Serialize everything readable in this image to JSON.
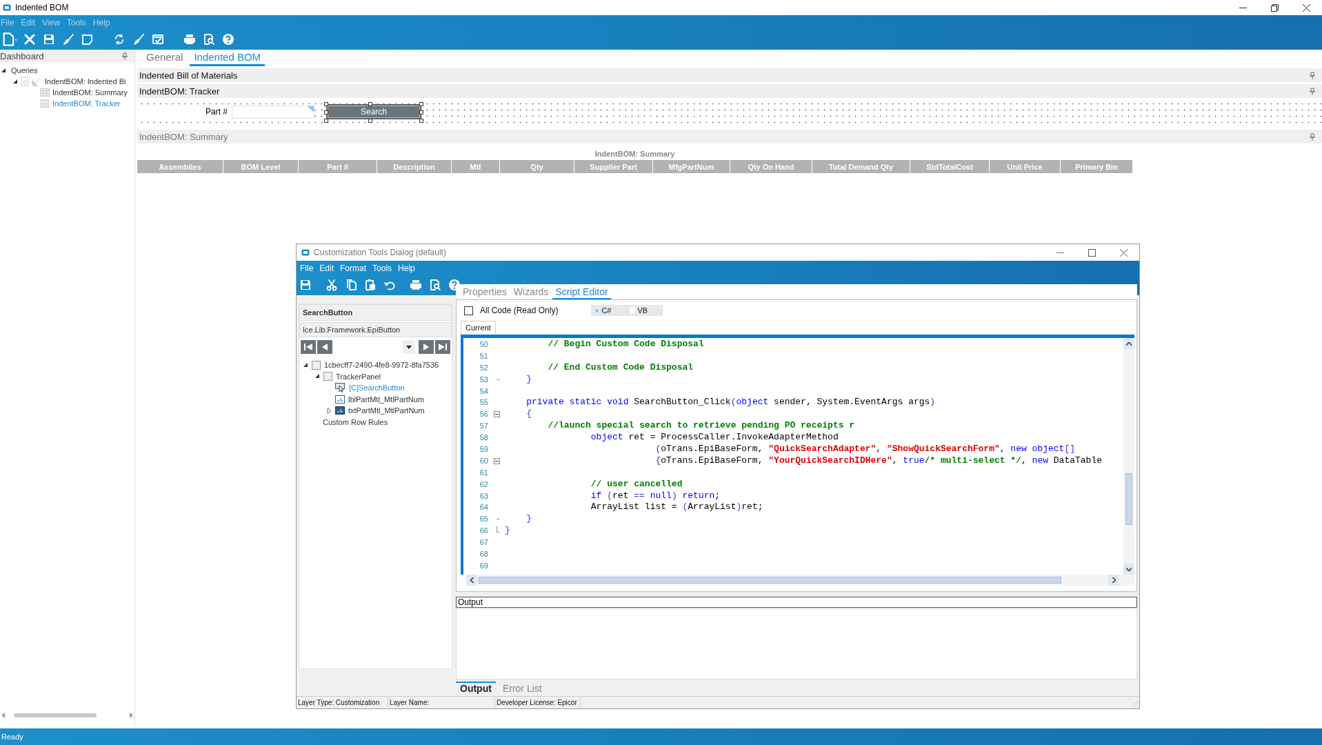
{
  "window": {
    "title": "Indented BOM"
  },
  "menu": [
    {
      "label": "File",
      "disabled": true
    },
    {
      "label": "Edit",
      "disabled": true
    },
    {
      "label": "View",
      "disabled": true
    },
    {
      "label": "Tools",
      "disabled": true
    },
    {
      "label": "Help",
      "disabled": true
    }
  ],
  "sidebar": {
    "title": "Dashboard",
    "tree": [
      {
        "label": "Queries",
        "expanded": true,
        "selected": false,
        "children": [
          {
            "label": "IndentBOM: Indented Bi",
            "kind": "query",
            "expanded": true,
            "selected": false,
            "children": [
              {
                "label": "IndentBOM: Summary",
                "kind": "grid",
                "selected": false
              },
              {
                "label": "IndentBOM: Tracker",
                "kind": "tracker",
                "selected": true
              }
            ]
          }
        ]
      }
    ]
  },
  "tabs": [
    {
      "label": "General",
      "selected": false
    },
    {
      "label": "Indented BOM",
      "selected": true
    }
  ],
  "header_panel": {
    "title": "Indented Bill of Materials"
  },
  "tracker": {
    "title": "IndentBOM: Tracker",
    "field_label": "Part #",
    "button": "Search"
  },
  "summary": {
    "title": "IndentBOM: Summary",
    "grid_title": "IndentBOM: Summary",
    "columns": [
      "Assemblies",
      "BOM Level",
      "Part #",
      "Description",
      "Mtl",
      "Qty",
      "Supplier Part",
      "MfgPartNum",
      "Qty On Hand",
      "Total Demand Qty",
      "StdTotalCost",
      "Unit Price",
      "Primary Bin"
    ]
  },
  "status_bar": "Ready",
  "dialog": {
    "title": "Customization Tools Dialog (default)",
    "menu": [
      "File",
      "Edit",
      "Format",
      "Tools",
      "Help"
    ],
    "control_name": "SearchButton",
    "control_type": "Ice.Lib.Framework.EpiButton",
    "tree": [
      {
        "label": "1cbecff7-2490-4fe8-9972-8fa7536",
        "kind": "panel",
        "expanded": true,
        "selected": false,
        "children": [
          {
            "label": "TrackerPanel",
            "kind": "panel",
            "expanded": true,
            "selected": false,
            "children": [
              {
                "label": "[C]SearchButton",
                "kind": "button",
                "selected": true
              },
              {
                "label": "lblPartMtl_MtlPartNum",
                "kind": "label",
                "selected": false
              },
              {
                "label": "txtPartMtl_MtlPartNum",
                "kind": "textbox",
                "expanded": false,
                "selected": false
              }
            ]
          }
        ]
      },
      {
        "label": "Custom Row Rules",
        "kind": "rules",
        "selected": false
      }
    ],
    "tabs": [
      {
        "label": "Properties",
        "selected": false
      },
      {
        "label": "Wizards",
        "selected": false
      },
      {
        "label": "Script Editor",
        "selected": true
      }
    ],
    "all_code": {
      "label": "All Code (Read Only)",
      "checked": false
    },
    "languages": [
      {
        "label": "C#",
        "selected": true
      },
      {
        "label": "VB",
        "selected": false
      }
    ],
    "code_tabs": [
      {
        "label": "Current",
        "selected": true
      }
    ],
    "code_lines": [
      {
        "number": "50",
        "kind": "plain",
        "tokens": [
          {
            "kind": "comment",
            "text": "        // Begin Custom Code Disposal"
          }
        ]
      },
      {
        "number": "51",
        "kind": "plain"
      },
      {
        "number": "52",
        "kind": "plain",
        "tokens": [
          {
            "kind": "comment",
            "text": "        // End Custom Code Disposal"
          }
        ]
      },
      {
        "number": "53",
        "kind": "end",
        "tokens": [
          {
            "kind": "punct",
            "text": "    }"
          }
        ]
      },
      {
        "number": "54",
        "kind": "plain"
      },
      {
        "number": "55",
        "kind": "plain",
        "tokens": [
          {
            "kind": "kw",
            "text": "    private static void"
          },
          {
            "kind": "plain",
            "text": " SearchButton_Click"
          },
          {
            "kind": "punct",
            "text": "("
          },
          {
            "kind": "kw",
            "text": "object"
          },
          {
            "kind": "plain",
            "text": " sender, System.EventArgs args"
          },
          {
            "kind": "punct",
            "text": ")"
          }
        ]
      },
      {
        "number": "56",
        "kind": "collapse",
        "tokens": [
          {
            "kind": "punct",
            "text": "    {"
          }
        ]
      },
      {
        "number": "57",
        "kind": "plain",
        "tokens": [
          {
            "kind": "comment",
            "text": "        //launch special search to retrieve pending PO receipts r"
          }
        ]
      },
      {
        "number": "58",
        "kind": "plain",
        "tokens": [
          {
            "kind": "kw",
            "text": "                object"
          },
          {
            "kind": "plain",
            "text": " ret = ProcessCaller.InvokeAdapterMethod"
          }
        ]
      },
      {
        "number": "59",
        "kind": "plain",
        "tokens": [
          {
            "kind": "punct",
            "text": "                            ("
          },
          {
            "kind": "plain",
            "text": "oTrans.EpiBaseForm, "
          },
          {
            "kind": "string",
            "text": "\"QuickSearchAdapter\""
          },
          {
            "kind": "plain",
            "text": ", "
          },
          {
            "kind": "string",
            "text": "\"ShowQuickSearchForm\""
          },
          {
            "kind": "plain",
            "text": ", "
          },
          {
            "kind": "kw",
            "text": "new object"
          },
          {
            "kind": "punct",
            "text": "[]"
          }
        ]
      },
      {
        "number": "60",
        "kind": "collapse",
        "tokens": [
          {
            "kind": "punct",
            "text": "                            {"
          },
          {
            "kind": "plain",
            "text": "oTrans.EpiBaseForm, "
          },
          {
            "kind": "string",
            "text": "\"YourQuickSearchIDHere\""
          },
          {
            "kind": "plain",
            "text": ", "
          },
          {
            "kind": "kw",
            "text": "true"
          },
          {
            "kind": "comment",
            "text": "/* multi-select */"
          },
          {
            "kind": "plain",
            "text": ", "
          },
          {
            "kind": "kw",
            "text": "new"
          },
          {
            "kind": "plain",
            "text": " DataTable"
          }
        ]
      },
      {
        "number": "61",
        "kind": "plain"
      },
      {
        "number": "62",
        "kind": "plain",
        "tokens": [
          {
            "kind": "comment",
            "text": "                // user cancelled"
          }
        ]
      },
      {
        "number": "63",
        "kind": "plain",
        "tokens": [
          {
            "kind": "kw",
            "text": "                if"
          },
          {
            "kind": "punct",
            "text": " ("
          },
          {
            "kind": "plain",
            "text": "ret "
          },
          {
            "kind": "punct",
            "text": "== "
          },
          {
            "kind": "kw",
            "text": "null"
          },
          {
            "kind": "punct",
            "text": ")"
          },
          {
            "kind": "kw",
            "text": " return"
          },
          {
            "kind": "plain",
            "text": ";"
          }
        ]
      },
      {
        "number": "64",
        "kind": "plain",
        "tokens": [
          {
            "kind": "plain",
            "text": "                ArrayList list = "
          },
          {
            "kind": "punct",
            "text": "("
          },
          {
            "kind": "plain",
            "text": "ArrayList"
          },
          {
            "kind": "punct",
            "text": ")"
          },
          {
            "kind": "plain",
            "text": "ret;"
          }
        ]
      },
      {
        "number": "65",
        "kind": "end",
        "tokens": [
          {
            "kind": "punct",
            "text": "    }"
          }
        ]
      },
      {
        "number": "66",
        "kind": "last",
        "tokens": [
          {
            "kind": "punct",
            "text": "}"
          }
        ]
      },
      {
        "number": "67",
        "kind": "plain"
      },
      {
        "number": "68",
        "kind": "plain"
      },
      {
        "number": "69",
        "kind": "plain"
      }
    ],
    "output_label": "Output",
    "output_tabs": [
      {
        "label": "Output",
        "selected": true
      },
      {
        "label": "Error List",
        "selected": false
      }
    ],
    "status": [
      "Layer Type:  Customization",
      "Layer Name:",
      "Developer License:  Epicor"
    ]
  }
}
